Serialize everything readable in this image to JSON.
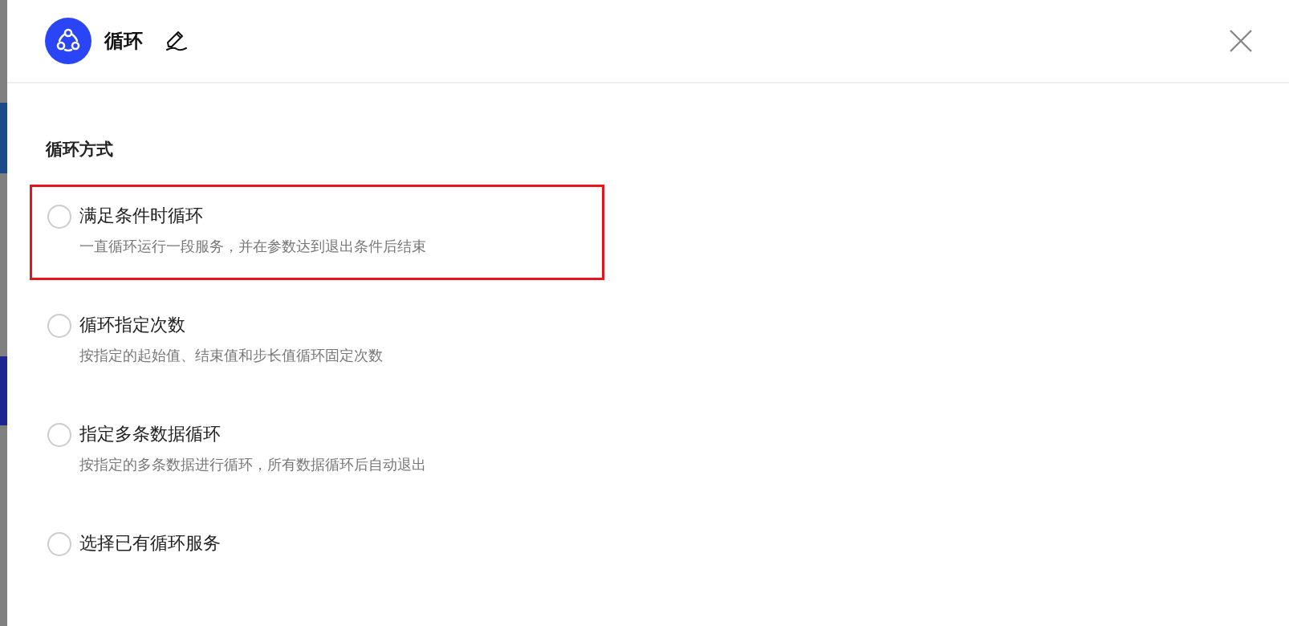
{
  "drawer": {
    "title": "循环"
  },
  "section": {
    "title": "循环方式"
  },
  "options": [
    {
      "label": "满足条件时循环",
      "description": "一直循环运行一段服务，并在参数达到退出条件后结束",
      "selected": false,
      "highlighted": true
    },
    {
      "label": "循环指定次数",
      "description": "按指定的起始值、结束值和步长值循环固定次数",
      "selected": false,
      "highlighted": false
    },
    {
      "label": "指定多条数据循环",
      "description": "按指定的多条数据进行循环，所有数据循环后自动退出",
      "selected": false,
      "highlighted": false
    },
    {
      "label": "选择已有循环服务",
      "selected": false,
      "highlighted": false
    }
  ]
}
